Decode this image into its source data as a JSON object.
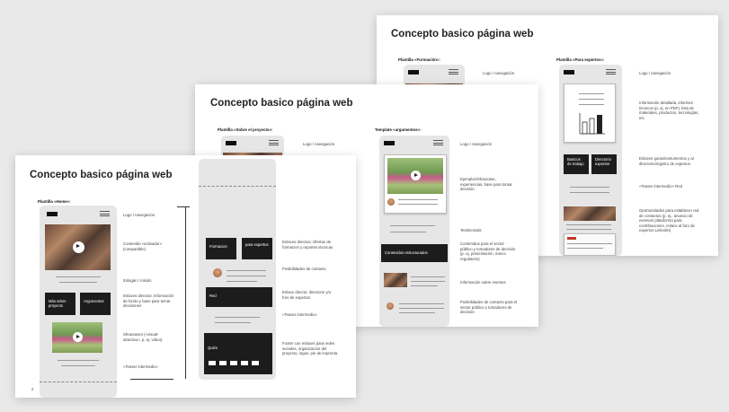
{
  "slide3": {
    "title": "Concepto basico página web",
    "col1_label": "Plantilla «Formación»:",
    "col1_note_logo": "Logo / navegación",
    "col2_label": "Plantilla «Para expertos»:",
    "col2_note_logo": "Logo / navegación",
    "note_info": "Información detallada, informes técnicos (p. ej. en PDF), lista de materiales, productos, tecnologías, etc.",
    "btn_a": "Basicos de trabajo",
    "btn_b": "Directorio expertos",
    "note_links": "Enlaces guías/instrumentos y al directorio/registro de expertos",
    "note_teaser": "«Teaser intermedio» Red",
    "note_opps": "Oportunidades para establecer red de contactos (p. ej., anuncio de eventos/ plataforma para contribuciones, enlace al foro de expertos LinkedIn)"
  },
  "slide2": {
    "title": "Concepto basico página web",
    "col1_label": "Plantilla «Sobre el proyecto»:",
    "col1_note_logo": "Logo / navegación",
    "col2_label": "Template «argumentos»:",
    "col2_note_logo": "Logo / navegación",
    "note_examples": "Ejemplos/Showcase, experiencias, base para tomar decisión",
    "note_testimonials": "Testimonials",
    "btn_content": "Contenidos estructurados",
    "note_content": "Contenidos para el sector público y tomadores de decisión (p. ej. presentación, marco regulatorio)",
    "note_events": "Información sobre eventos",
    "note_contact": "Posibilidades de contacto para el sector público y tomadores de decisión"
  },
  "slide1": {
    "title": "Concepto basico página web",
    "label": "Plantilla «Home»:",
    "note_logo": "Logo / navegación",
    "note_video": "Contenido «activador» (compartible)",
    "note_slogan": "Eslogan / misión",
    "btn_a": "Más sobre proyecto",
    "btn_b": "Argumentos",
    "note_links": "Enlaces directos: Información de fondo y base para tomar decisiones",
    "note_showcase": "Showcases («visual-atractivo», p. ej. vídeo)",
    "note_teaser": "«Teaser intermedio»",
    "page_num": "2",
    "ext_btn_a": "Formacion",
    "ext_btn_b": "para expertos",
    "ext_note_links": "Enlaces directos: Ofertas de formacion y reportes técnicas",
    "ext_note_contact": "Posibilidades de contacto",
    "ext_btn_red": "Red",
    "ext_note_red": "Enlace directo: directorio y/o foro de expertos",
    "ext_note_teaser": "«Teaser intermedio»",
    "ext_footer_label": "Quién",
    "ext_note_footer": "Footer con enlaces para redes sociales, organización del proyecto, logos, pie de imprenta"
  },
  "colors": {
    "background": "#e9e9e9",
    "slide": "#ffffff",
    "phone": "#e6e6e6",
    "button": "#1c1c1c"
  }
}
